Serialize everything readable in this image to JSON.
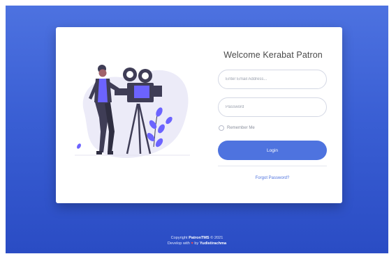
{
  "login_card": {
    "title": "Welcome Kerabat Patron",
    "email_placeholder": "Enter Email Address...",
    "password_placeholder": "Password",
    "remember_label": "Remember Me",
    "login_label": "Login",
    "forgot_label": "Forgot Password?"
  },
  "footer": {
    "copyright_prefix": "Copyright",
    "brand": "PatronTMS",
    "copyright_suffix": "© 2021",
    "develop_prefix": "Develop with",
    "develop_by": "by",
    "developer": "Yudistirachma"
  },
  "icons": {
    "heart": "heart-icon",
    "illustration": "videographer-illustration"
  },
  "colors": {
    "primary": "#4e73df",
    "background_top": "#4d72e0",
    "background_bottom": "#2a4cc4",
    "heart": "#e74a5a"
  }
}
